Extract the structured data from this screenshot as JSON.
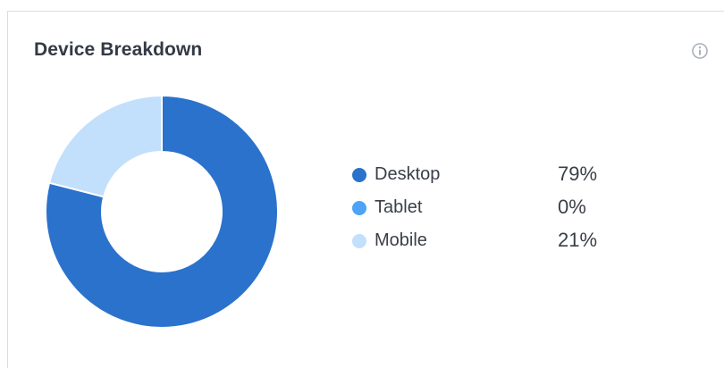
{
  "card": {
    "title": "Device Breakdown",
    "info_icon": "info-circle-icon"
  },
  "chart_data": {
    "type": "pie",
    "style": "donut",
    "categories": [
      "Desktop",
      "Tablet",
      "Mobile"
    ],
    "values": [
      79,
      0,
      21
    ],
    "value_labels": [
      "79%",
      "0%",
      "21%"
    ],
    "colors": [
      "#2b72cc",
      "#4da3f5",
      "#c2dffc"
    ],
    "legend": "right"
  }
}
